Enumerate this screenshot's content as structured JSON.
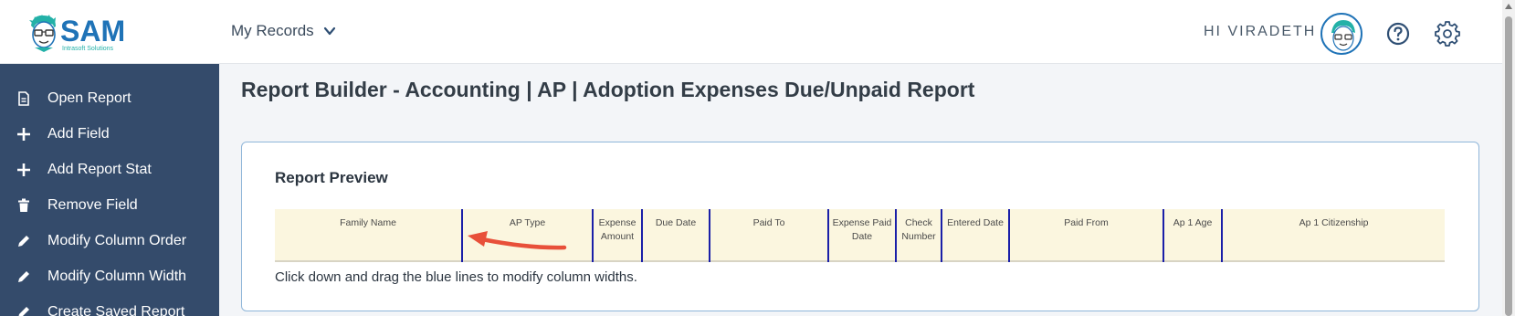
{
  "header": {
    "logo_text": "SAM",
    "logo_subtitle": "Intrasoft Solutions",
    "nav_menu": "My Records",
    "greeting": "HI VIRADETH"
  },
  "sidebar": {
    "items": [
      {
        "label": "Open Report",
        "icon": "document-icon"
      },
      {
        "label": "Add Field",
        "icon": "plus-icon"
      },
      {
        "label": "Add Report Stat",
        "icon": "plus-icon"
      },
      {
        "label": "Remove Field",
        "icon": "trash-icon"
      },
      {
        "label": "Modify Column Order",
        "icon": "pencil-icon"
      },
      {
        "label": "Modify Column Width",
        "icon": "pencil-icon"
      },
      {
        "label": "Create Saved Report",
        "icon": "pencil-icon"
      }
    ]
  },
  "main": {
    "title": "Report Builder - Accounting | AP | Adoption Expenses Due/Unpaid Report",
    "card_title": "Report Preview",
    "columns": [
      {
        "line1": "Family Name",
        "line2": ""
      },
      {
        "line1": "AP Type",
        "line2": ""
      },
      {
        "line1": "Expense",
        "line2": "Amount"
      },
      {
        "line1": "Due Date",
        "line2": ""
      },
      {
        "line1": "Paid To",
        "line2": ""
      },
      {
        "line1": "Expense Paid",
        "line2": "Date"
      },
      {
        "line1": "Check",
        "line2": "Number"
      },
      {
        "line1": "Entered Date",
        "line2": ""
      },
      {
        "line1": "Paid From",
        "line2": ""
      },
      {
        "line1": "Ap 1 Age",
        "line2": ""
      },
      {
        "line1": "Ap 1 Citizenship",
        "line2": ""
      }
    ],
    "hint": "Click down and drag the blue lines to modify column widths."
  },
  "colors": {
    "brand": "#1f73b7",
    "sidebar_bg": "#344b6b",
    "table_header_bg": "#fbf6df",
    "column_divider": "#1a1fa8",
    "annotation_arrow": "#e8503a"
  }
}
